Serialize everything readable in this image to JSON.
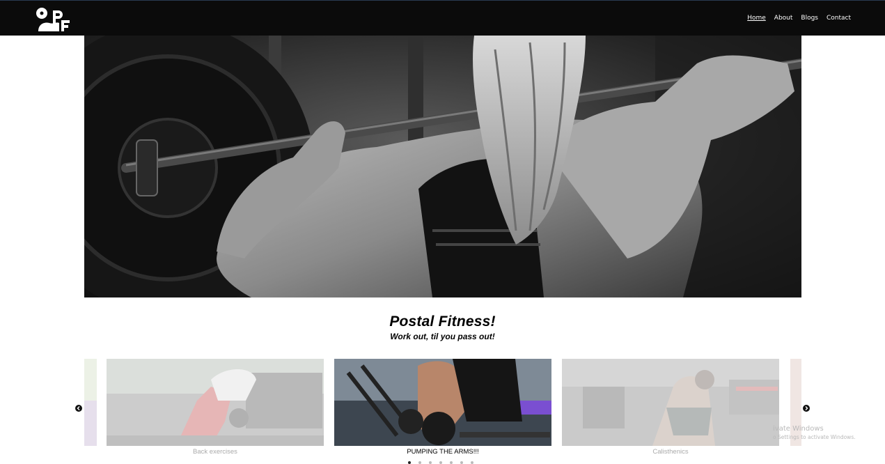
{
  "nav": {
    "links": [
      {
        "label": "Home",
        "active": true
      },
      {
        "label": "About",
        "active": false
      },
      {
        "label": "Blogs",
        "active": false
      },
      {
        "label": "Contact",
        "active": false
      }
    ]
  },
  "logo": {
    "letters": "PF"
  },
  "hero": {
    "image": "black-and-white-barbell-squat-photo"
  },
  "headline": {
    "title": "Postal Fitness!",
    "subtitle": "Work out, til you pass out!"
  },
  "carousel": {
    "cards": [
      {
        "label": "Back exercises",
        "state": "dim"
      },
      {
        "label": "PUMPING THE ARMS!!!",
        "state": "active"
      },
      {
        "label": "Calisthenics",
        "state": "dim"
      }
    ],
    "dots": 7,
    "active_dot": 0,
    "prev_icon": "chevron-left-icon",
    "next_icon": "chevron-right-icon"
  },
  "watermark": {
    "line1": "ivate Windows",
    "line2": "o Settings to activate Windows."
  },
  "colors": {
    "navbar_bg": "#0b0b0b",
    "text_dim": "#aaaaaa"
  }
}
